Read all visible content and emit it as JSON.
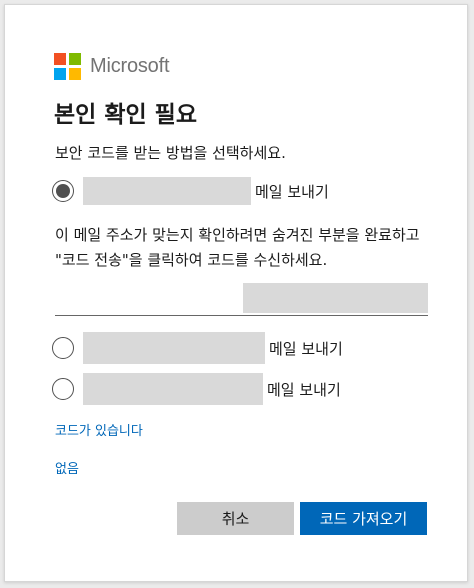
{
  "brand": {
    "name": "Microsoft",
    "logo_colors": [
      "#f25022",
      "#7fba00",
      "#00a4ef",
      "#ffb900"
    ]
  },
  "title": "본인 확인 필요",
  "subtitle": "보안 코드를 받는 방법을 선택하세요.",
  "options": [
    {
      "label": "메일 보내기",
      "selected": true
    },
    {
      "label": "메일 보내기",
      "selected": false
    },
    {
      "label": "메일 보내기",
      "selected": false
    }
  ],
  "description": "이 메일 주소가 맞는지 확인하려면 숨겨진 부분을 완료하고 \"코드 전송\"을 클릭하여 코드를 수신하세요.",
  "links": {
    "have_code": "코드가 있습니다",
    "none": "없음"
  },
  "buttons": {
    "cancel": "취소",
    "get_code": "코드 가져오기"
  },
  "colors": {
    "accent": "#0067b8",
    "cancel_bg": "#cccccc",
    "redacted": "#d9d9d9"
  }
}
